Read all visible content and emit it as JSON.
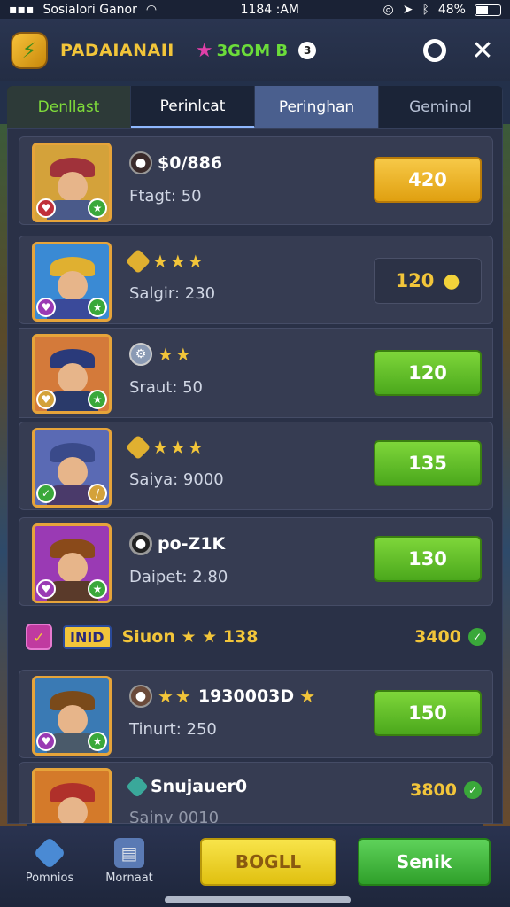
{
  "status_bar": {
    "carrier": "Sosialori Ganor",
    "time": "1184 :AM",
    "battery": "48%"
  },
  "header": {
    "title": "PADAIANAII",
    "subtitle": "3GOM B",
    "subtitle_badge": "3"
  },
  "tabs": [
    {
      "label": "Denllast"
    },
    {
      "label": "Perinlcat"
    },
    {
      "label": "Peringhan"
    },
    {
      "label": "Geminol"
    }
  ],
  "rows": [
    {
      "name": "$0/886",
      "stat": "Ftagt: 50",
      "price": "420",
      "button_style": "yellow",
      "stars": "",
      "avatar_color": "#d4a23a",
      "hat_color": "#a0323a",
      "body_color": "#4a5a8a"
    },
    {
      "name": "",
      "stars": "★★★",
      "stat": "Salgir: 230",
      "price": "120",
      "button_style": "dark",
      "avatar_color": "#3a8ad4",
      "hat_color": "#e0b030",
      "body_color": "#3a4a9a"
    },
    {
      "name": "",
      "stars": "★★",
      "stat": "Sraut: 50",
      "price": "120",
      "button_style": "green",
      "avatar_color": "#d47a3a",
      "hat_color": "#2a3a7a",
      "body_color": "#2a3a6a"
    },
    {
      "name": "",
      "stars": "★★★",
      "stat": "Saiya: 9000",
      "price": "135",
      "button_style": "green",
      "avatar_color": "#5a6ab4",
      "hat_color": "#3a4a8a",
      "body_color": "#4a3a6a"
    },
    {
      "name": "po-Z1K",
      "stars": "",
      "stat": "Daipet: 2.80",
      "price": "130",
      "button_style": "green",
      "avatar_color": "#9a3ab4",
      "hat_color": "#8a4a1a",
      "body_color": "#5a3a2a"
    }
  ],
  "vip": {
    "tag": "INID",
    "text": "Siuon ★ ★ 138",
    "value": "3400"
  },
  "rows2": [
    {
      "name": "1930003D",
      "stars_pre": "★★",
      "stars_post": "★",
      "stat": "Tinurt: 250",
      "price": "150",
      "avatar_color": "#3a7ab4",
      "hat_color": "#7a4a1a",
      "body_color": "#4a5a6a"
    },
    {
      "name": "Snujauer0",
      "stat": "Sainy 0010",
      "price": "3800",
      "avatar_color": "#d47a2a",
      "hat_color": "#b0302a",
      "body_color": "#6a3a2a"
    }
  ],
  "bottom_nav": {
    "item1": "Pomnios",
    "item2": "Mornaat",
    "button_yellow": "BOGLL",
    "button_green": "Senik"
  }
}
